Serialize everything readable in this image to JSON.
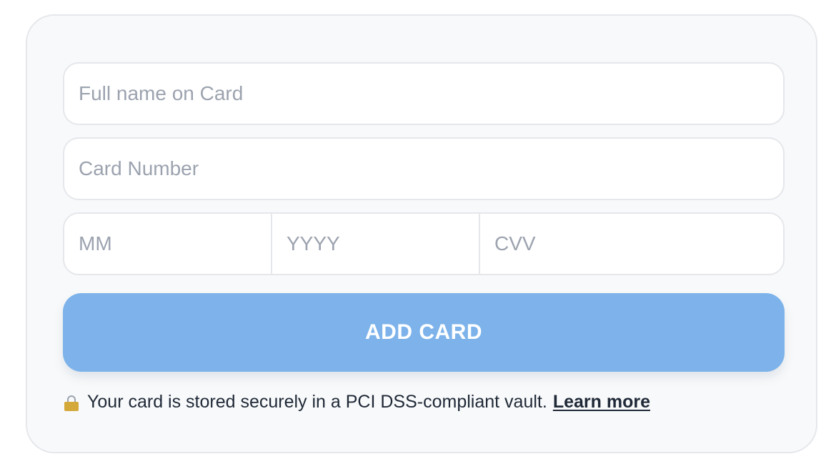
{
  "form": {
    "name_placeholder": "Full name on Card",
    "number_placeholder": "Card Number",
    "month_placeholder": "MM",
    "year_placeholder": "YYYY",
    "cvv_placeholder": "CVV",
    "submit_label": "ADD CARD",
    "submit_color": "#7db3ea"
  },
  "footer": {
    "lock_icon": "lock-icon",
    "note": "Your card is stored securely in a PCI DSS-compliant vault.",
    "link_label": "Learn more"
  }
}
